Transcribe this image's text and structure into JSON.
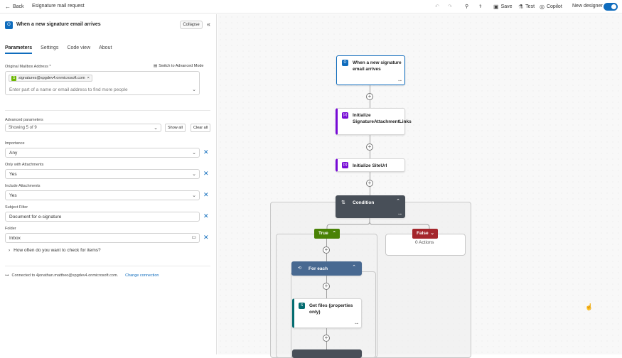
{
  "topbar": {
    "back_label": "Back",
    "flow_title": "Esignature mail request",
    "save_label": "Save",
    "test_label": "Test",
    "copilot_label": "Copilot",
    "new_designer_label": "New designer"
  },
  "panel": {
    "title": "When a new signature email arrives",
    "collapse_label": "Collapse",
    "tabs": [
      "Parameters",
      "Settings",
      "Code view",
      "About"
    ],
    "mailbox_label": "Original Mailbox Address *",
    "switch_mode_label": "Switch to Advanced Mode",
    "mailbox_chip": "signatures@spgdev4.onmicrosoft.com",
    "mailbox_placeholder": "Enter part of a name or email address to find more people",
    "advanced_label": "Advanced parameters",
    "advanced_value": "Showing 5 of 9",
    "show_all": "Show all",
    "clear_all": "Clear all",
    "importance_label": "Importance",
    "importance_value": "Any",
    "attachments_label": "Only with Attachments",
    "attachments_value": "Yes",
    "include_label": "Include Attachments",
    "include_value": "Yes",
    "subject_label": "Subject Filter",
    "subject_value": "Document for e-signature",
    "folder_label": "Folder",
    "folder_value": "Inbox",
    "how_often": "How often do you want to check for items?",
    "connected_text": "Connected to 4jonathan.mattheo@spgdev4.onmicrosoft.com.",
    "change_connection": "Change connection"
  },
  "canvas": {
    "trigger": "When a new signature email arrives",
    "init_attachments": "Initialize SignatureAttachmentLinks",
    "init_siteurl": "Initialize SiteUrl",
    "condition": "Condition",
    "true_label": "True",
    "false_label": "False",
    "false_actions": "0 Actions",
    "foreach": "For each",
    "getfiles": "Get files (properties only)"
  },
  "colors": {
    "accent": "#0f6cbd",
    "condition": "#484f58",
    "true": "#498205",
    "false": "#a4262c",
    "foreach": "#486991",
    "variable": "#770bd6",
    "sharepoint": "#036c70"
  }
}
